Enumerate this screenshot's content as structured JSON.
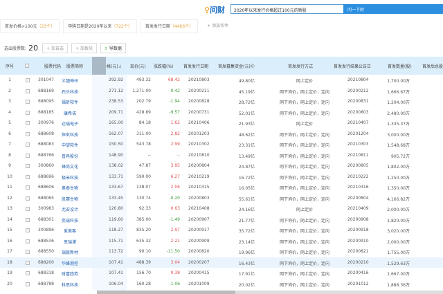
{
  "header": {
    "logo": "问财",
    "search_value": "2020年以来发行价格超过100元的新股",
    "search_button": "问一下财"
  },
  "conditions": [
    {
      "label": "首发价格>100元",
      "count": "（23个）"
    },
    {
      "label": "申购日期是2020年以来",
      "count": "（722个）"
    },
    {
      "label": "首发发行日期",
      "count": "（4466个）"
    }
  ],
  "add_condition": "+ 添加条件",
  "toolbar": {
    "label": "选出股票数:",
    "count": "20",
    "add_watch": "+ 加自选",
    "add_block": "+ 加板块",
    "export": "导数据"
  },
  "columns": [
    "序号",
    "股票代码",
    "股票简称",
    "首发价格(元)↓",
    "现价(元)",
    "涨跌幅(%)",
    "首发发行日期",
    "首发募集资金(元)⓪",
    "首发发行方式",
    "首发发行结果公告日",
    "首发数量(股)",
    "首发后总股"
  ],
  "rows": [
    [
      "1",
      "301047",
      "义翘神州",
      "292.92",
      "493.32",
      "68.42",
      "20210803",
      "49.80亿",
      "网上定价",
      "20210804",
      "1,700.00万"
    ],
    [
      "2",
      "688169",
      "石头科技",
      "271.12",
      "1,271.00",
      "-0.42",
      "20200211",
      "45.19亿",
      "网下询价，网上定价，定向",
      "20200212",
      "1,666.67万"
    ],
    [
      "3",
      "688095",
      "福昕软件",
      "238.53",
      "202.79",
      "-1.94",
      "20200828",
      "28.72亿",
      "网下询价，网上定价，定向",
      "20200831",
      "1,204.00万"
    ],
    [
      "4",
      "688185",
      "康希诺",
      "209.71",
      "428.89",
      "-9.57",
      "20200731",
      "52.01亿",
      "网下询价，网上定价，定向",
      "20200803",
      "2,480.00万"
    ],
    [
      "5",
      "300976",
      "达瑞电子",
      "165.00",
      "84.18",
      "1.62",
      "20210406",
      "21.93亿",
      "网上定价",
      "20210407",
      "1,335.37万"
    ],
    [
      "6",
      "688608",
      "恒玄科技",
      "162.07",
      "311.00",
      "2.82",
      "20201203",
      "48.62亿",
      "网下询价，网上定价，定向",
      "20201204",
      "3,000.00万"
    ],
    [
      "7",
      "688083",
      "中望软件",
      "150.50",
      "543.78",
      "2.99",
      "20210302",
      "23.31亿",
      "网下询价，网上定价，定向",
      "20210303",
      "1,548.68万"
    ],
    [
      "8",
      "688766",
      "普冉股份",
      "148.90",
      "--",
      "--",
      "20210810",
      "13.49亿",
      "网下询价，网上定价，定向",
      "20210811",
      "905.72万"
    ],
    [
      "9",
      "300860",
      "锋尚文化",
      "138.02",
      "47.87",
      "3.95",
      "20200804",
      "24.87亿",
      "网下询价，网上定价，定向",
      "20200805",
      "1,802.00万"
    ],
    [
      "10",
      "688696",
      "极米科技",
      "133.71",
      "590.00",
      "6.27",
      "20210219",
      "16.72亿",
      "网下询价，网上定价，定向",
      "20210222",
      "1,250.00万"
    ],
    [
      "11",
      "688606",
      "奥泰生物",
      "133.67",
      "138.07",
      "2.06",
      "20210315",
      "16.05亿",
      "网下询价，网上定价，定向",
      "20210316",
      "1,350.00万"
    ],
    [
      "12",
      "688065",
      "凯赛生物",
      "133.45",
      "130.74",
      "-0.20",
      "20200803",
      "55.61亿",
      "网下询价，网上定价，定向",
      "20200804",
      "4,166.82万"
    ],
    [
      "13",
      "300983",
      "尤安设计",
      "120.80",
      "92.33",
      "0.63",
      "20210408",
      "24.16亿",
      "网上定价",
      "20210409",
      "2,000.00万"
    ],
    [
      "14",
      "688301",
      "奕瑞科技",
      "119.60",
      "385.00",
      "-1.49",
      "20200907",
      "21.77亿",
      "网下询价，网上定价，定向",
      "20200908",
      "1,820.00万"
    ],
    [
      "15",
      "300896",
      "爱美客",
      "118.27",
      "835.20",
      "2.97",
      "20200917",
      "35.72亿",
      "网下询价，网上定价，定向",
      "20200918",
      "3,020.00万"
    ],
    [
      "16",
      "688536",
      "思瑞浦",
      "115.71",
      "635.32",
      "2.21",
      "20200909",
      "23.14亿",
      "网下询价，网上定价，定向",
      "20200910",
      "2,000.00万"
    ],
    [
      "17",
      "688550",
      "瑞联新材",
      "113.72",
      "90.10",
      "-11.50",
      "20200820",
      "19.96亿",
      "网下询价，网上定价，定向",
      "20200821",
      "1,755.00万"
    ],
    [
      "18",
      "688200",
      "华峰测控",
      "107.41",
      "488.39",
      "3.04",
      "20200207",
      "16.43亿",
      "网下询价，网上定价，定向",
      "20200210",
      "1,529.63万"
    ],
    [
      "19",
      "688318",
      "财富趋势",
      "107.41",
      "156.70",
      "0.38",
      "20200415",
      "17.91亿",
      "网下询价，网上定价，定向",
      "20200416",
      "1,667.00万"
    ],
    [
      "20",
      "688788",
      "科思科技",
      "106.04",
      "160.28",
      "-1.06",
      "20201009",
      "20.02亿",
      "网下询价，网上定价，定向",
      "20201012",
      "1,888.36万"
    ]
  ]
}
